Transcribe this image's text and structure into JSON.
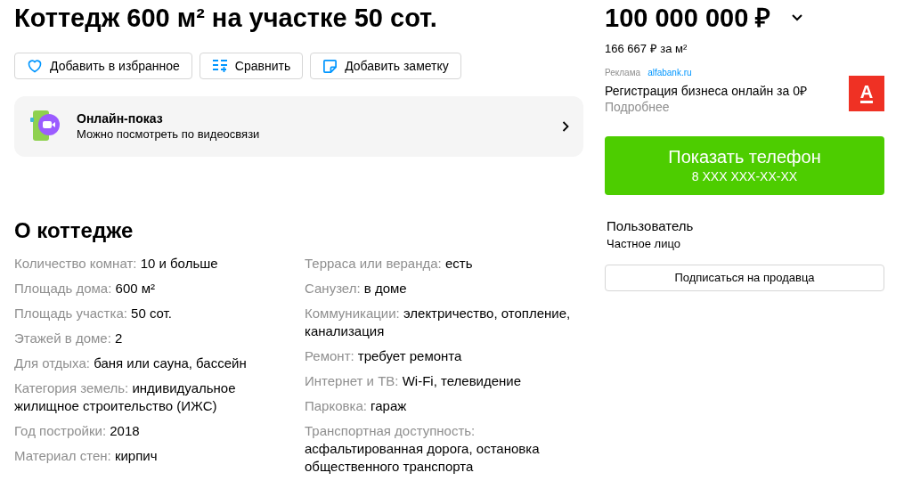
{
  "title": "Коттедж 600 м² на участке 50 сот.",
  "actions": [
    {
      "kind": "favorite",
      "label": "Добавить в избранное"
    },
    {
      "kind": "compare",
      "label": "Сравнить"
    },
    {
      "kind": "note",
      "label": "Добавить заметку"
    }
  ],
  "online_show": {
    "title": "Онлайн-показ",
    "subtitle": "Можно посмотреть по видеосвязи"
  },
  "section_title": "О коттедже",
  "params_left": [
    {
      "label": "Количество комнат:",
      "value": "10 и больше"
    },
    {
      "label": "Площадь дома:",
      "value": "600 м²"
    },
    {
      "label": "Площадь участка:",
      "value": "50 сот."
    },
    {
      "label": "Этажей в доме:",
      "value": "2"
    },
    {
      "label": "Для отдыха:",
      "value": "баня или сауна, бассейн"
    },
    {
      "label": "Категория земель:",
      "value": "индивидуальное жилищное строительство (ИЖС)"
    },
    {
      "label": "Год постройки:",
      "value": "2018"
    },
    {
      "label": "Материал стен:",
      "value": "кирпич"
    }
  ],
  "params_right": [
    {
      "label": "Терраса или веранда:",
      "value": "есть"
    },
    {
      "label": "Санузел:",
      "value": "в доме"
    },
    {
      "label": "Коммуникации:",
      "value": "электричество, отопление, канализация"
    },
    {
      "label": "Ремонт:",
      "value": "требует ремонта"
    },
    {
      "label": "Интернет и ТВ:",
      "value": "Wi-Fi, телевидение"
    },
    {
      "label": "Парковка:",
      "value": "гараж"
    },
    {
      "label": "Транспортная доступность:",
      "value": "асфальтированная дорога, остановка общественного транспорта"
    }
  ],
  "price": "100 000 000 ₽",
  "price_per_m2": "166 667 ₽ за м²",
  "ad": {
    "label": "Реклама",
    "domain": "alfabank.ru",
    "text": "Регистрация бизнеса онлайн за 0₽",
    "more": "Подробнее",
    "logo_letter": "А"
  },
  "phone_button": {
    "label": "Показать телефон",
    "phone": "8 XXX XXX-XX-XX"
  },
  "seller": {
    "name": "Пользователь",
    "type": "Частное лицо"
  },
  "subscribe_button": "Подписаться на продавца"
}
